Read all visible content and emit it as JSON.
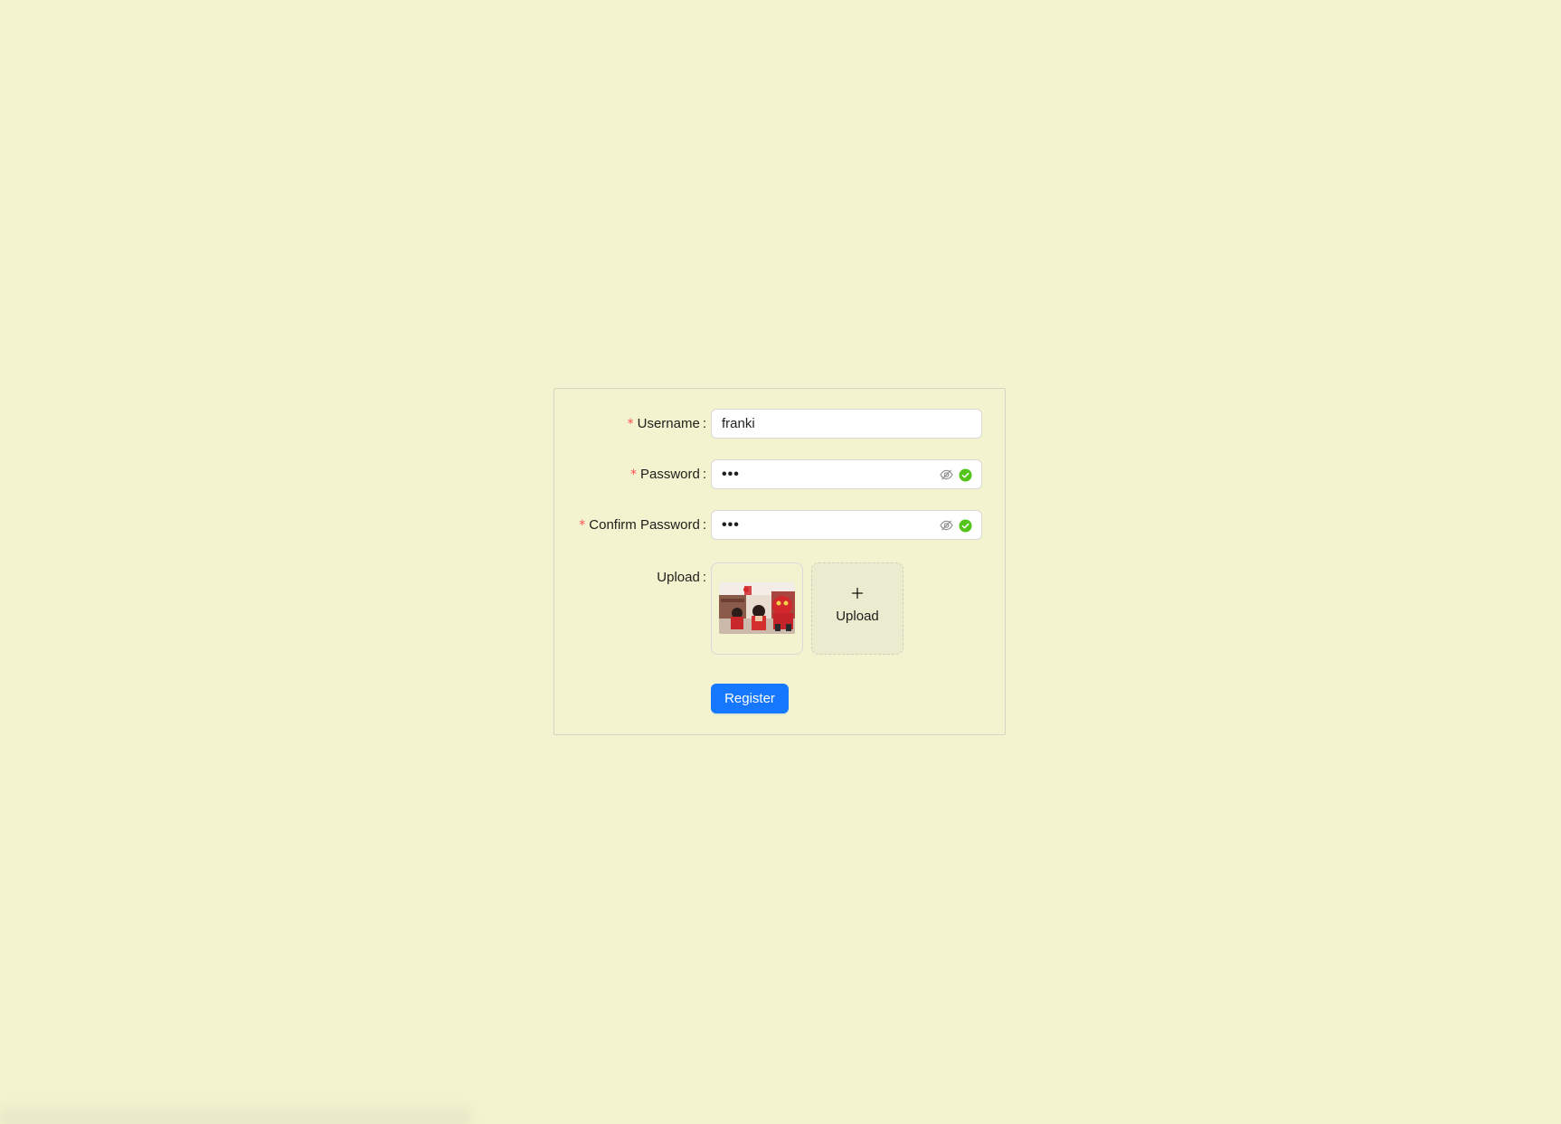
{
  "page": {
    "background_color": "#f3f3d0",
    "accent_color": "#1677ff",
    "required_color": "#ff4d4f",
    "success_color": "#52c41a"
  },
  "form": {
    "username": {
      "label": "Username",
      "required": true,
      "value": "franki"
    },
    "password": {
      "label": "Password",
      "required": true,
      "masked_value": "•••",
      "icons": [
        "eye-invisible-icon",
        "check-circle-icon"
      ]
    },
    "confirm_password": {
      "label": "Confirm Password",
      "required": true,
      "masked_value": "•••",
      "icons": [
        "eye-invisible-icon",
        "check-circle-icon"
      ]
    },
    "upload": {
      "label": "Upload",
      "required": false,
      "button_label": "Upload",
      "button_icon": "plus-icon"
    },
    "register_label": "Register",
    "required_mark": "*",
    "colon": ":"
  }
}
